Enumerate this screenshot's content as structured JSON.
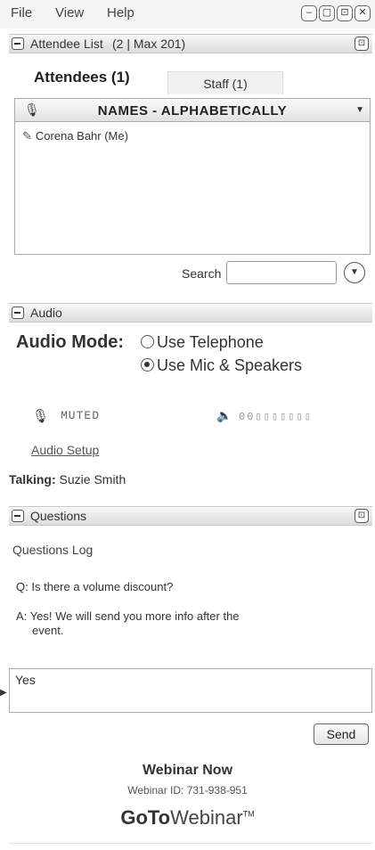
{
  "menu": {
    "file": "File",
    "view": "View",
    "help": "Help"
  },
  "window_controls": {
    "minimize": "–",
    "restore": "▢",
    "popout": "⊡",
    "close": "✕"
  },
  "attendee_section": {
    "title": "Attendee List",
    "count": "(2 | Max 201)"
  },
  "tabs": {
    "attendees": "Attendees (1)",
    "staff": "Staff (1)"
  },
  "list": {
    "header": "NAMES - ALPHABETICALLY",
    "attendees": [
      {
        "name": "Corena Bahr (Me)"
      }
    ]
  },
  "search": {
    "label": "Search",
    "value": ""
  },
  "audio_section": {
    "title": "Audio"
  },
  "audio": {
    "mode_label": "Audio Mode:",
    "options": [
      {
        "label": "Use Telephone",
        "selected": false
      },
      {
        "label": "Use Mic & Speakers",
        "selected": true
      }
    ],
    "mic_status": "MUTED",
    "level_meter": "00",
    "setup_link": "Audio Setup",
    "talking_label": "Talking:",
    "talking_name": "Suzie Smith"
  },
  "questions_section": {
    "title": "Questions"
  },
  "questions": {
    "log_label": "Questions Log",
    "items": [
      {
        "prefix": "Q:",
        "text": "Is there a volume discount?"
      },
      {
        "prefix": "A:",
        "text": "Yes! We will send you more info after the",
        "continuation": "event."
      }
    ],
    "reply_value": "Yes",
    "send_label": "Send"
  },
  "footer": {
    "webinar_title": "Webinar Now",
    "webinar_id": "Webinar ID: 731-938-951",
    "brand_goto": "GoTo",
    "brand_webinar": "Webinar",
    "brand_tm": "TM"
  }
}
